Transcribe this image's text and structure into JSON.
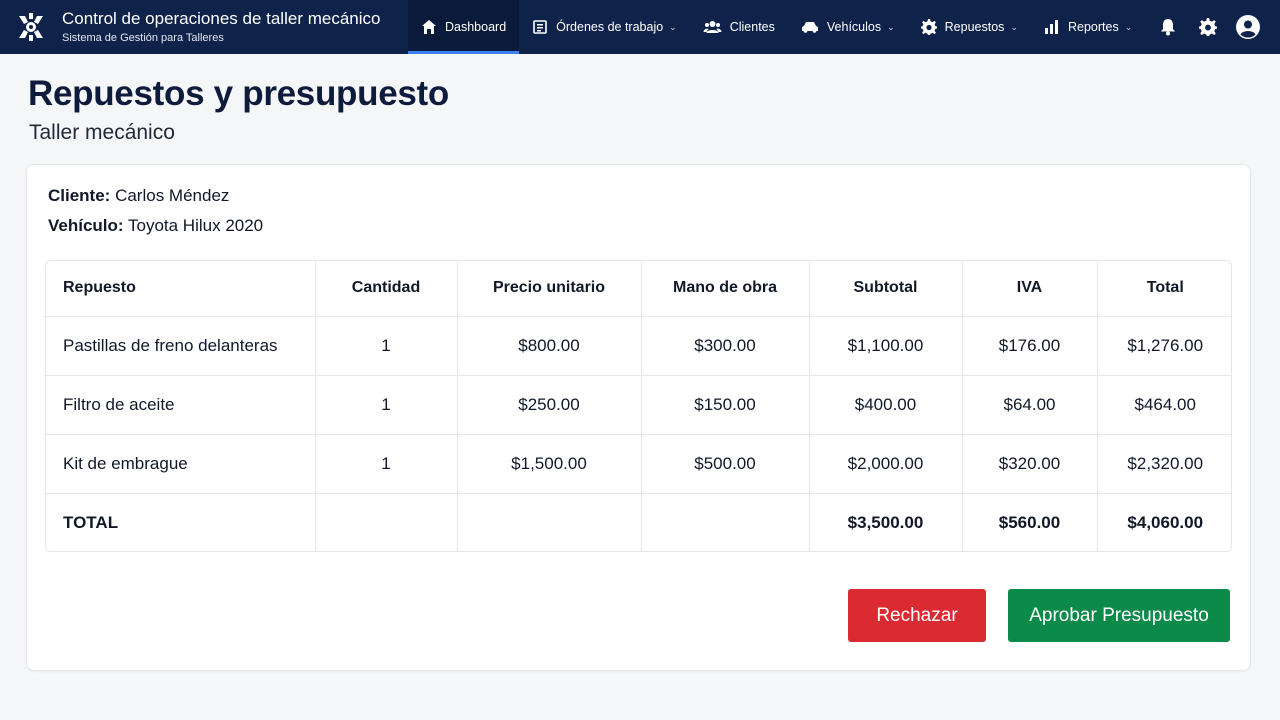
{
  "app": {
    "title": "Control de operaciones de taller mecánico",
    "subtitle": "Sistema de Gestión para Talleres"
  },
  "nav": [
    {
      "label": "Dashboard",
      "icon": "home-icon",
      "active": true,
      "dropdown": false
    },
    {
      "label": "Órdenes de trabajo",
      "icon": "list-icon",
      "active": false,
      "dropdown": true
    },
    {
      "label": "Clientes",
      "icon": "users-icon",
      "active": false,
      "dropdown": false
    },
    {
      "label": "Vehículos",
      "icon": "car-icon",
      "active": false,
      "dropdown": true
    },
    {
      "label": "Repuestos",
      "icon": "gear-icon",
      "active": false,
      "dropdown": true
    },
    {
      "label": "Reportes",
      "icon": "bar-chart-icon",
      "active": false,
      "dropdown": true
    }
  ],
  "nav_right_icons": [
    "bell-icon",
    "settings-icon",
    "user-avatar-icon"
  ],
  "page": {
    "title": "Repuestos y presupuesto",
    "subtitle": "Taller mecánico"
  },
  "customer": {
    "client_label": "Cliente:",
    "client_value": "Carlos Méndez",
    "vehicle_label": "Vehículo:",
    "vehicle_value": "Toyota Hilux 2020"
  },
  "table": {
    "headers": [
      "Repuesto",
      "Cantidad",
      "Precio unitario",
      "Mano de obra",
      "Subtotal",
      "IVA",
      "Total"
    ],
    "rows": [
      [
        "Pastillas de freno delanteras",
        "1",
        "$800.00",
        "$300.00",
        "$1,100.00",
        "$176.00",
        "$1,276.00"
      ],
      [
        "Filtro de aceite",
        "1",
        "$250.00",
        "$150.00",
        "$400.00",
        "$64.00",
        "$464.00"
      ],
      [
        "Kit de embrague",
        "1",
        "$1,500.00",
        "$500.00",
        "$2,000.00",
        "$320.00",
        "$2,320.00"
      ]
    ],
    "total_row": [
      "TOTAL",
      "",
      "",
      "",
      "$3,500.00",
      "$560.00",
      "$4,060.00"
    ]
  },
  "actions": {
    "reject_label": "Rechazar",
    "approve_label": "Aprobar Presupuesto"
  },
  "colors": {
    "navbar": "#0f2249",
    "active_indicator": "#3b82f6",
    "reject": "#dc2a32",
    "approve": "#0b8a4a"
  }
}
